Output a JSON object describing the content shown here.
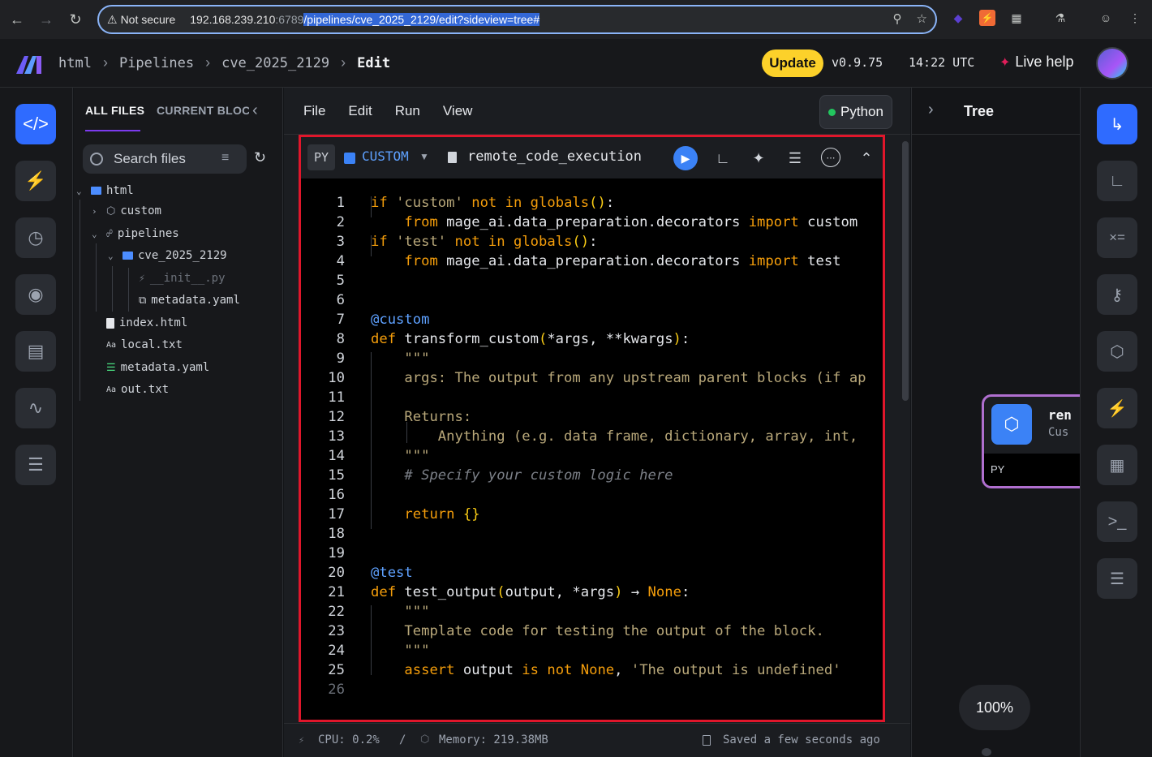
{
  "browser": {
    "not_secure": "Not secure",
    "host": "192.168.239.210",
    "port": ":6789",
    "path": "/pipelines/cve_2025_2129/edit?sideview=tree#"
  },
  "header": {
    "breadcrumbs": [
      "html",
      "Pipelines",
      "cve_2025_2129"
    ],
    "current": "Edit",
    "update_label": "Update",
    "version": "v0.9.75",
    "time": "14:22 UTC",
    "live_help": "Live help"
  },
  "files": {
    "tab_all": "ALL FILES",
    "tab_current": "CURRENT BLOCK",
    "search_placeholder": "Search files",
    "tree": {
      "root": "html",
      "custom": "custom",
      "pipelines": "pipelines",
      "pipeline": "cve_2025_2129",
      "init": "__init__.py",
      "metadata_inner": "metadata.yaml",
      "index": "index.html",
      "local": "local.txt",
      "metadata": "metadata.yaml",
      "out": "out.txt"
    }
  },
  "editor": {
    "menu": [
      "File",
      "Edit",
      "Run",
      "View"
    ],
    "kernel": "Python",
    "block": {
      "lang": "PY",
      "type": "CUSTOM",
      "name": "remote_code_execution"
    },
    "status": {
      "cpu": "CPU: 0.2%",
      "divider": "/",
      "memory": "Memory: 219.38MB",
      "saved": "Saved a few seconds ago"
    }
  },
  "tree_panel": {
    "title": "Tree",
    "node_title": "ren",
    "node_subtitle": "Cus",
    "node_lang": "PY",
    "zoom": "100%"
  },
  "colors": {
    "accent": "#2f6bff",
    "update": "#fcd12a",
    "highlight_border": "#e0162b",
    "keyword": "#f59e0b",
    "decorator": "#5ea1ff"
  }
}
